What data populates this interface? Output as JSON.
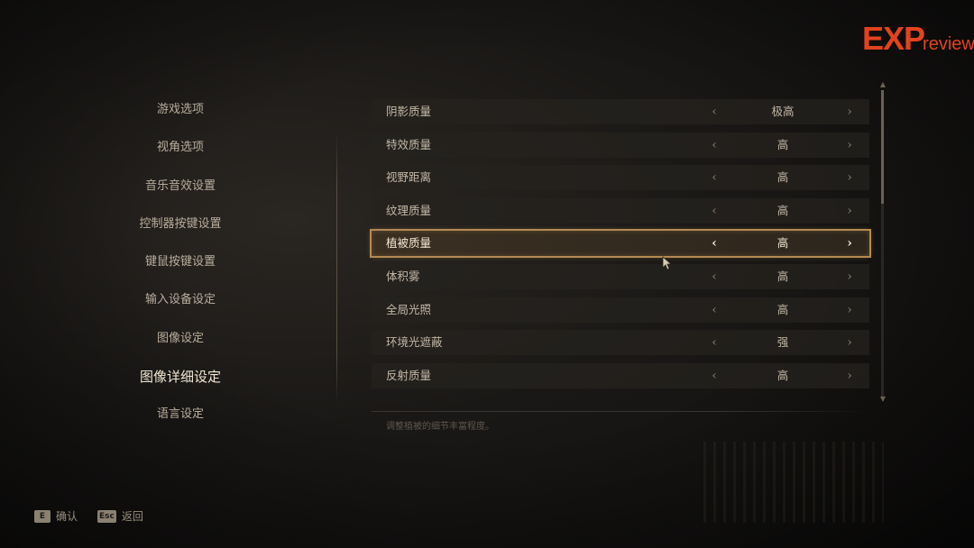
{
  "logo": {
    "main": "EXP",
    "sub": "review"
  },
  "menu": {
    "items": [
      {
        "label": "游戏选项"
      },
      {
        "label": "视角选项"
      },
      {
        "label": "音乐音效设置"
      },
      {
        "label": "控制器按键设置"
      },
      {
        "label": "键鼠按键设置"
      },
      {
        "label": "输入设备设定"
      },
      {
        "label": "图像设定"
      },
      {
        "label": "图像详细设定",
        "active": true
      },
      {
        "label": "语言设定"
      }
    ]
  },
  "settings": [
    {
      "label": "阴影质量",
      "value": "极高"
    },
    {
      "label": "特效质量",
      "value": "高"
    },
    {
      "label": "视野距离",
      "value": "高"
    },
    {
      "label": "纹理质量",
      "value": "高"
    },
    {
      "label": "植被质量",
      "value": "高",
      "selected": true
    },
    {
      "label": "体积雾",
      "value": "高"
    },
    {
      "label": "全局光照",
      "value": "高"
    },
    {
      "label": "环境光遮蔽",
      "value": "强"
    },
    {
      "label": "反射质量",
      "value": "高"
    }
  ],
  "arrows": {
    "left": "‹",
    "right": "›"
  },
  "description": "调整植被的细节丰富程度。",
  "hints": [
    {
      "key": "E",
      "label": "确认"
    },
    {
      "key": "Esc",
      "label": "返回"
    }
  ],
  "scroll": {
    "position": 0.0,
    "visible_fraction": 0.37
  },
  "colors": {
    "accent": "#b48a52",
    "logo": "#e3421e"
  }
}
